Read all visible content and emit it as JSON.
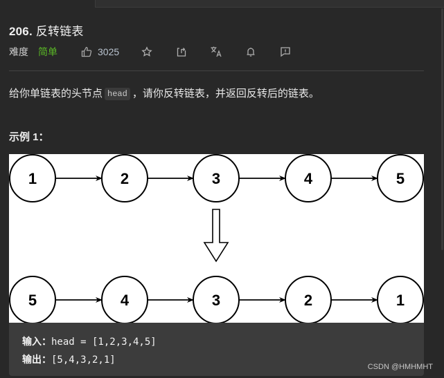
{
  "problem": {
    "number": "206.",
    "title": "反转链表",
    "difficulty_label": "难度",
    "difficulty_value": "简单",
    "likes": "3025",
    "icons": [
      "thumbs-up-icon",
      "star-icon",
      "share-icon",
      "translate-icon",
      "bell-icon",
      "feedback-icon"
    ]
  },
  "description": {
    "before": "给你单链表的头节点",
    "code": "head",
    "after": "，请你反转链表，并返回反转后的链表。"
  },
  "example": {
    "title": "示例 1：",
    "diagram": {
      "top_row": [
        "1",
        "2",
        "3",
        "4",
        "5"
      ],
      "bottom_row": [
        "5",
        "4",
        "3",
        "2",
        "1"
      ]
    },
    "input_label": "输入：",
    "input_value": "head = [1,2,3,4,5]",
    "output_label": "输出：",
    "output_value": "[5,4,3,2,1]"
  },
  "watermark": "CSDN @HMHMHT",
  "colors": {
    "background": "#282828",
    "easy": "#5ab726",
    "code_bg": "#3c3c3c"
  }
}
